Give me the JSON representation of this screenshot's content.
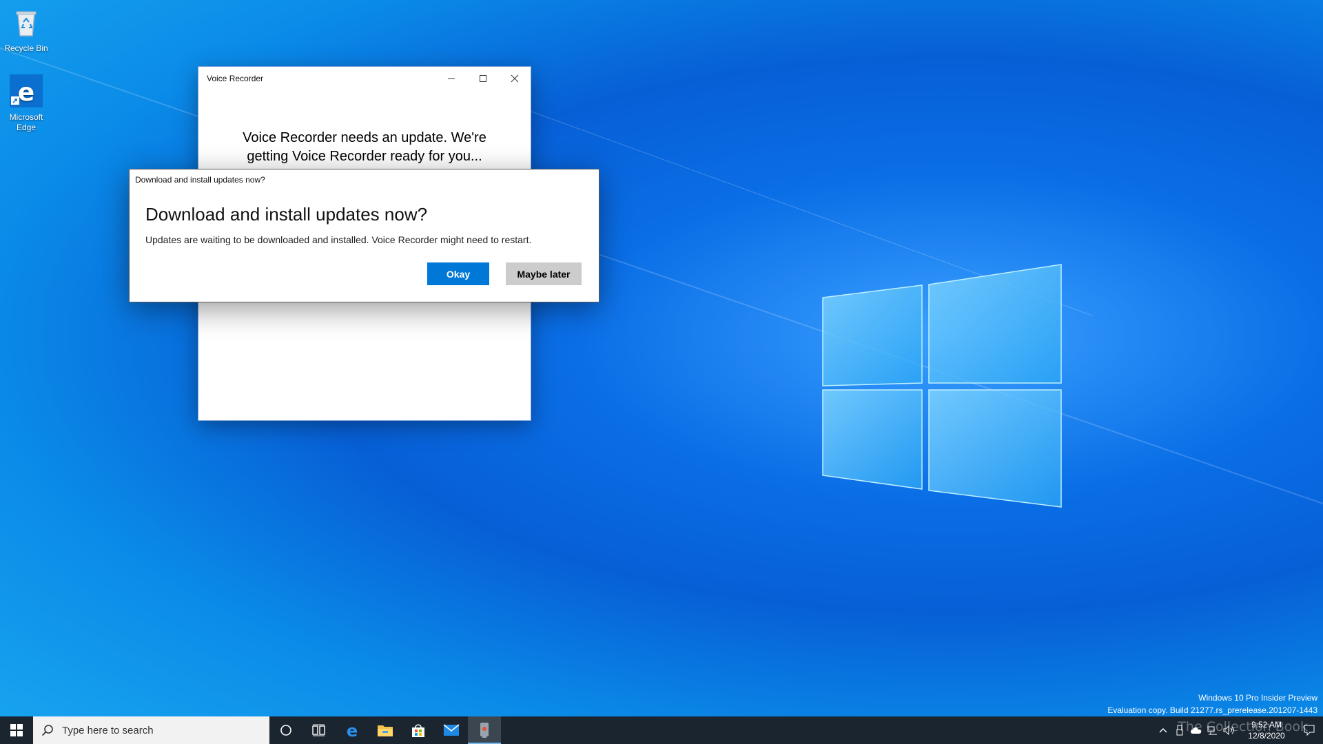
{
  "desktop": {
    "icons": [
      {
        "label": "Recycle Bin",
        "icon": "recycle-bin-icon"
      },
      {
        "label": "Microsoft Edge",
        "icon": "edge-icon"
      }
    ]
  },
  "voice_recorder": {
    "title": "Voice Recorder",
    "message_line1": "Voice Recorder needs an update. We're",
    "message_line2": "getting Voice Recorder ready for you..."
  },
  "dialog": {
    "caption": "Download and install updates now?",
    "heading": "Download and install updates now?",
    "text": "Updates are waiting to be downloaded and installed. Voice Recorder might need to restart.",
    "ok_label": "Okay",
    "later_label": "Maybe later"
  },
  "watermark": {
    "line1": "Windows 10 Pro Insider Preview",
    "line2": "Evaluation copy. Build 21277.rs_prerelease.201207-1443"
  },
  "taskbar": {
    "search_placeholder": "Type here to search",
    "pinned": [
      "cortana-icon",
      "task-view-icon",
      "edge-icon",
      "file-explorer-icon",
      "store-icon",
      "mail-icon",
      "voice-recorder-icon"
    ],
    "active_app": "voice-recorder-icon"
  },
  "tray": {
    "time": "9:52 AM",
    "date": "12/8/2020",
    "icons": [
      "chevron-up-icon",
      "usb-icon",
      "onedrive-icon",
      "network-icon",
      "volume-icon"
    ]
  },
  "brand_overlay": "The Collection Book",
  "colors": {
    "accent": "#0078d7",
    "taskbar": "#1b2530",
    "secondary_button": "#cccccc"
  }
}
